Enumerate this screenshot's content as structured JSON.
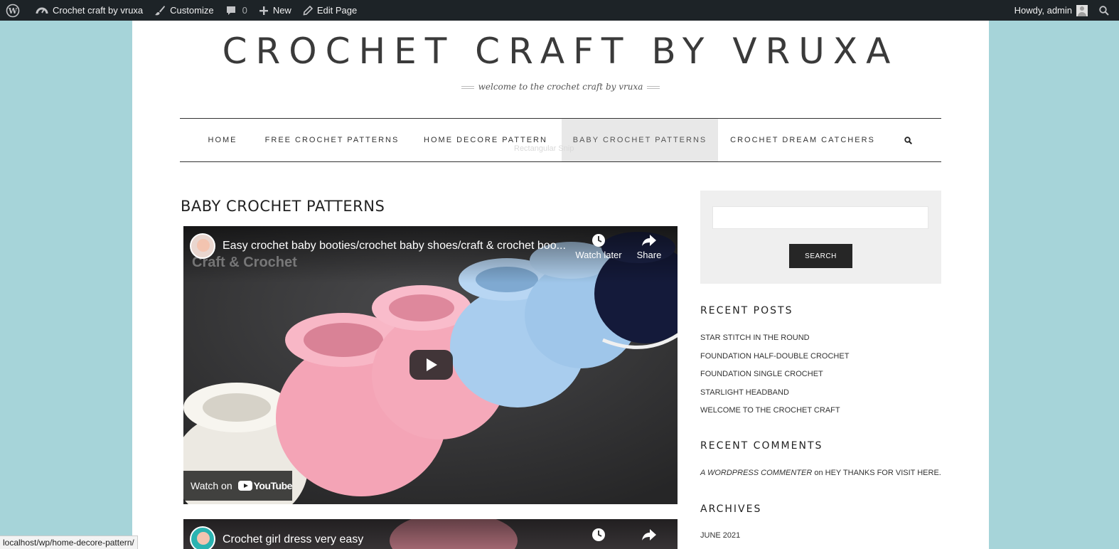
{
  "admin_bar": {
    "site_name": "Crochet craft by vruxa",
    "customize": "Customize",
    "comments_count": "0",
    "new": "New",
    "edit_page": "Edit Page",
    "howdy": "Howdy, admin"
  },
  "header": {
    "site_title": "CROCHET CRAFT BY VRUXA",
    "tagline": "welcome to the crochet craft by vruxa"
  },
  "nav": {
    "items": [
      {
        "label": "HOME"
      },
      {
        "label": "FREE CROCHET PATTERNS"
      },
      {
        "label": "HOME DECORE PATTERN"
      },
      {
        "label": "BABY CROCHET PATTERNS",
        "active": true
      },
      {
        "label": "CROCHET DREAM CATCHERS"
      }
    ],
    "ghost_text": "Rectangular Snip"
  },
  "main": {
    "heading": "BABY CROCHET PATTERNS",
    "videos": [
      {
        "title": "Easy crochet baby booties/crochet baby shoes/craft & crochet boo...",
        "watermark": "Craft & Crochet",
        "watch_later": "Watch later",
        "share": "Share",
        "watch_on": "Watch on",
        "youtube": "YouTube"
      },
      {
        "title": "Crochet girl dress very easy"
      }
    ]
  },
  "sidebar": {
    "search_button": "SEARCH",
    "search_value": "",
    "recent_posts_title": "RECENT POSTS",
    "recent_posts": [
      "STAR STITCH IN THE ROUND",
      "FOUNDATION HALF-DOUBLE CROCHET",
      "FOUNDATION SINGLE CROCHET",
      "STARLIGHT HEADBAND",
      "WELCOME TO THE CROCHET CRAFT"
    ],
    "recent_comments_title": "RECENT COMMENTS",
    "comment": {
      "author": "A WORDPRESS COMMENTER",
      "on": "on",
      "post": "HEY THANKS FOR VISIT HERE."
    },
    "archives_title": "ARCHIVES",
    "archives": [
      "JUNE 2021"
    ]
  },
  "status_bar": {
    "url": "localhost/wp/home-decore-pattern/"
  },
  "colors": {
    "background": "#a6d4d9",
    "admin_bar": "#1d2327",
    "button_dark": "#262626",
    "nav_active": "#e8e8e8"
  }
}
